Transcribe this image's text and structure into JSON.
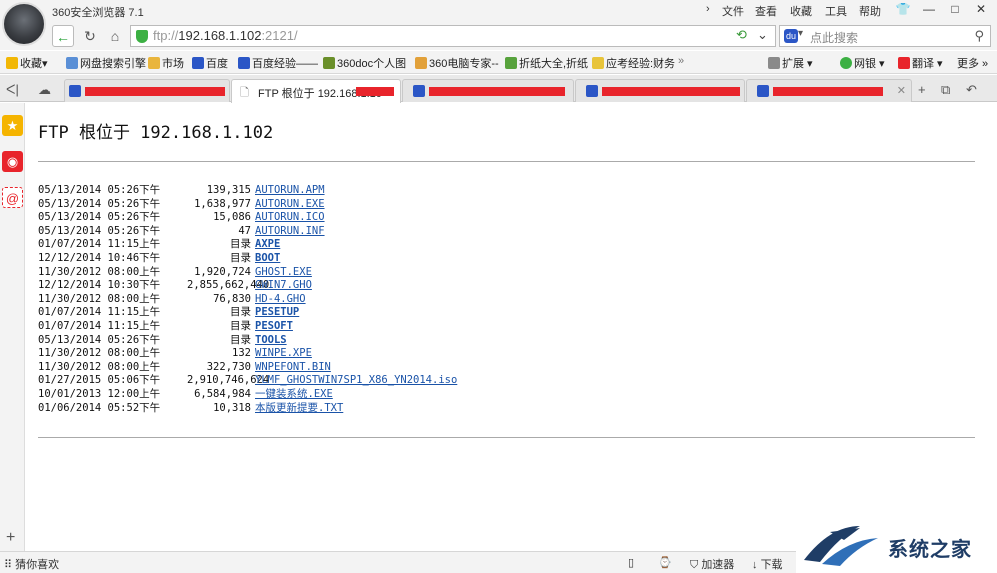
{
  "window": {
    "title": "360安全浏览器 7.1",
    "menu": [
      "文件",
      "查看",
      "收藏",
      "工具",
      "帮助"
    ],
    "controls": [
      "shirt-icon",
      "minimize-icon",
      "maximize-icon",
      "close-icon"
    ]
  },
  "navbar": {
    "url_scheme": "ftp://",
    "url_host": "192.168.1.102",
    "url_port": ":2121/",
    "search_placeholder": "点此搜索"
  },
  "bookmarks": {
    "items": [
      "收藏",
      "网盘搜索引擎",
      "市场",
      "百度",
      "百度经验——",
      "360doc个人图",
      "360电脑专家--",
      "折纸大全,折纸",
      "应考经验:财务"
    ],
    "right": [
      "扩展",
      "网银",
      "翻译",
      "更多"
    ]
  },
  "tabs": {
    "active_title": "FTP 根位于 192.168.1.10"
  },
  "content": {
    "heading": "FTP 根位于 192.168.1.102",
    "dir_label": "目录",
    "entries": [
      {
        "date": "05/13/2014 05:26下午",
        "size": "139,315",
        "name": "AUTORUN.APM",
        "dir": false
      },
      {
        "date": "05/13/2014 05:26下午",
        "size": "1,638,977",
        "name": "AUTORUN.EXE",
        "dir": false
      },
      {
        "date": "05/13/2014 05:26下午",
        "size": "15,086",
        "name": "AUTORUN.ICO",
        "dir": false
      },
      {
        "date": "05/13/2014 05:26下午",
        "size": "47",
        "name": "AUTORUN.INF",
        "dir": false
      },
      {
        "date": "01/07/2014 11:15上午",
        "size": "",
        "name": "AXPE",
        "dir": true
      },
      {
        "date": "12/12/2014 10:46下午",
        "size": "",
        "name": "BOOT",
        "dir": true
      },
      {
        "date": "11/30/2012 08:00上午",
        "size": "1,920,724",
        "name": "GHOST.EXE",
        "dir": false
      },
      {
        "date": "12/12/2014 10:30下午",
        "size": "2,855,662,440",
        "name": "GWIN7.GHO",
        "dir": false
      },
      {
        "date": "11/30/2012 08:00上午",
        "size": "76,830",
        "name": "HD-4.GHO",
        "dir": false
      },
      {
        "date": "01/07/2014 11:15上午",
        "size": "",
        "name": "PESETUP",
        "dir": true
      },
      {
        "date": "01/07/2014 11:15上午",
        "size": "",
        "name": "PESOFT",
        "dir": true
      },
      {
        "date": "05/13/2014 05:26下午",
        "size": "",
        "name": "TOOLS",
        "dir": true
      },
      {
        "date": "11/30/2012 08:00上午",
        "size": "132",
        "name": "WINPE.XPE",
        "dir": false
      },
      {
        "date": "11/30/2012 08:00上午",
        "size": "322,730",
        "name": "WNPEFONT.BIN",
        "dir": false
      },
      {
        "date": "01/27/2015 05:06下午",
        "size": "2,910,746,624",
        "name": "YLMF_GHOSTWIN7SP1_X86_YN2014.iso",
        "dir": false
      },
      {
        "date": "10/01/2013 12:00上午",
        "size": "6,584,984",
        "name": "一键装系统.EXE",
        "dir": false
      },
      {
        "date": "01/06/2014 05:52下午",
        "size": "10,318",
        "name": "本版更新提要.TXT",
        "dir": false
      }
    ]
  },
  "statusbar": {
    "left": "猜你喜欢",
    "accelerator": "加速器",
    "download": "下载"
  },
  "watermark": {
    "text": "系统之家"
  }
}
